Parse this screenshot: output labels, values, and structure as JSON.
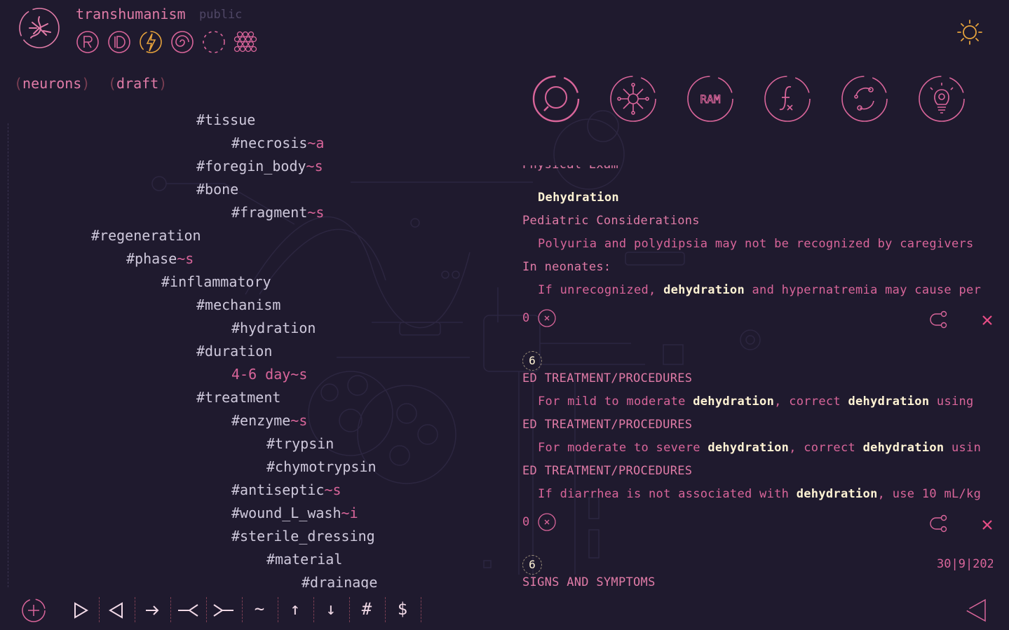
{
  "header": {
    "title": "transhumanism",
    "visibility": "public",
    "icons": [
      "r-letter-icon",
      "d-letter-icon",
      "lightning-icon",
      "spiral-icon",
      "dashed-circle-icon",
      "hexagon-grid-icon"
    ]
  },
  "tabs": [
    {
      "label": "neurons"
    },
    {
      "label": "draft"
    }
  ],
  "tools": [
    "search-icon",
    "neuron-icon",
    "ram-icon",
    "function-icon",
    "cycle-icon",
    "lightbulb-icon"
  ],
  "tree": [
    {
      "indent": 5,
      "text": "#tissue",
      "suffix": ""
    },
    {
      "indent": 6,
      "text": "#necrosis",
      "suffix": "~a"
    },
    {
      "indent": 5,
      "text": "#foregin_body",
      "suffix": "~s"
    },
    {
      "indent": 5,
      "text": "#bone",
      "suffix": ""
    },
    {
      "indent": 6,
      "text": "#fragment",
      "suffix": "~s"
    },
    {
      "indent": 2,
      "text": "#regeneration",
      "suffix": ""
    },
    {
      "indent": 3,
      "text": "#phase",
      "suffix": "~s"
    },
    {
      "indent": 4,
      "text": "#inflammatory",
      "suffix": ""
    },
    {
      "indent": 5,
      "text": "#mechanism",
      "suffix": ""
    },
    {
      "indent": 6,
      "text": "#hydration",
      "suffix": ""
    },
    {
      "indent": 5,
      "text": "#duration",
      "suffix": ""
    },
    {
      "indent": 6,
      "text": "4-6 day",
      "suffix": "~s",
      "plain": true
    },
    {
      "indent": 5,
      "text": "#treatment",
      "suffix": ""
    },
    {
      "indent": 6,
      "text": "#enzyme",
      "suffix": "~s"
    },
    {
      "indent": 7,
      "text": "#trypsin",
      "suffix": ""
    },
    {
      "indent": 7,
      "text": "#chymotrypsin",
      "suffix": ""
    },
    {
      "indent": 6,
      "text": "#antiseptic",
      "suffix": "~s"
    },
    {
      "indent": 6,
      "text": "#wound_L_wash",
      "suffix": "~i"
    },
    {
      "indent": 6,
      "text": "#sterile_dressing",
      "suffix": ""
    },
    {
      "indent": 7,
      "text": "#material",
      "suffix": ""
    },
    {
      "indent": 8,
      "text": "#drainage",
      "suffix": ""
    }
  ],
  "results": {
    "group1": {
      "cut_heading": "Physical Exam",
      "keyword": "Dehydration",
      "heading2": "Pediatric Considerations",
      "line2": "Polyuria and polydipsia may not be recognized by caregivers",
      "heading3": "In neonates:",
      "line3_pre": "If unrecognized, ",
      "line3_kw": "dehydration",
      "line3_post": " and hypernatremia may cause per",
      "count": "0"
    },
    "group2": {
      "badge": "6",
      "h1": "ED TREATMENT/PROCEDURES",
      "l1_pre": "For mild to moderate ",
      "l1_kw1": "dehydration",
      "l1_mid": ", correct ",
      "l1_kw2": "dehydration",
      "l1_post": " using",
      "h2": "ED TREATMENT/PROCEDURES",
      "l2_pre": "For moderate to severe ",
      "l2_kw1": "dehydration",
      "l2_mid": ", correct ",
      "l2_kw2": "dehydration",
      "l2_post": " usin",
      "h3": "ED TREATMENT/PROCEDURES",
      "l3_pre": "If diarrhea is not associated with ",
      "l3_kw": "dehydration",
      "l3_post": ", use 10 mL/kg",
      "count": "0"
    },
    "group3": {
      "badge": "6",
      "h1": "SIGNS AND SYMPTOMS",
      "date": "30|9|202"
    }
  },
  "toolbar": {
    "buttons": [
      "play-icon",
      "back-icon",
      "arrow-right-icon",
      "collapse-left-icon",
      "collapse-right-icon",
      "~",
      "↑",
      "↓",
      "#",
      "$"
    ]
  },
  "colors": {
    "background": "#1f1a2e",
    "accent": "#e07ba7",
    "highlight": "#fff3d4"
  }
}
